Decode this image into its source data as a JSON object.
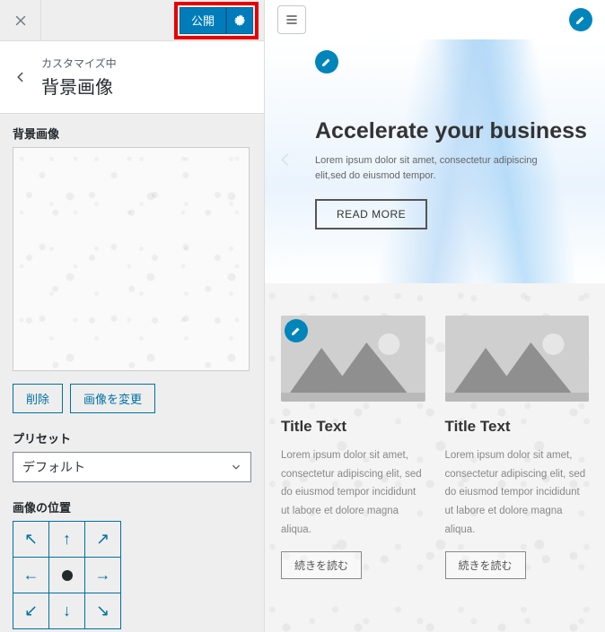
{
  "panel": {
    "publish_label": "公開",
    "crumb": "カスタマイズ中",
    "section_title": "背景画像",
    "bg_label": "背景画像",
    "delete_label": "削除",
    "change_label": "画像を変更",
    "preset_label": "プリセット",
    "preset_value": "デフォルト",
    "position_label": "画像の位置"
  },
  "preview": {
    "hero_title": "Accelerate your business",
    "hero_text": "Lorem ipsum dolor sit amet, consectetur adipiscing elit,sed do eiusmod tempor.",
    "hero_button": "READ MORE",
    "cards": [
      {
        "title": "Title Text",
        "text": "Lorem ipsum dolor sit amet, consectetur adipiscing elit, sed do eiusmod tempor incididunt ut labore et dolore magna aliqua.",
        "button": "続きを読む"
      },
      {
        "title": "Title Text",
        "text": "Lorem ipsum dolor sit amet, consectetur adipiscing elit, sed do eiusmod tempor incididunt ut labore et dolore magna aliqua.",
        "button": "続きを読む"
      }
    ]
  }
}
